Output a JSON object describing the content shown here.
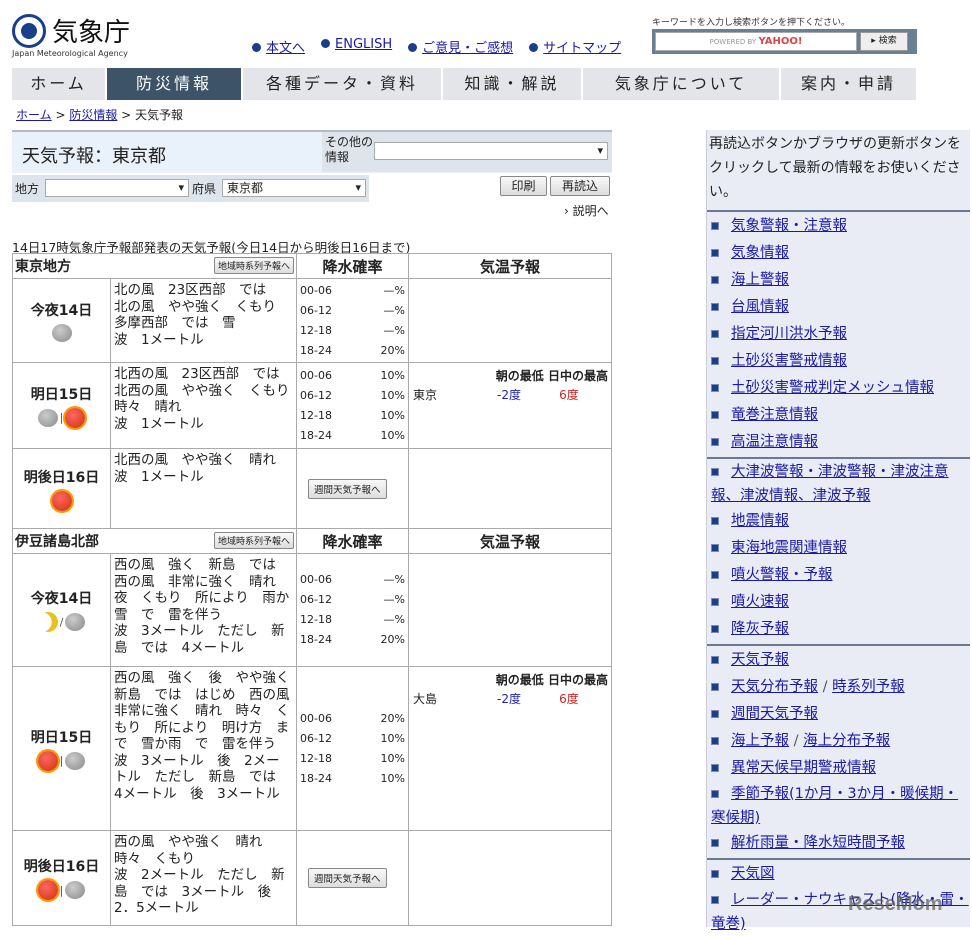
{
  "header": {
    "logo_text": "気象庁",
    "logo_sub": "Japan Meteorological Agency",
    "links": [
      "本文へ",
      "ENGLISH",
      "ご意見・ご感想",
      "サイトマップ"
    ],
    "search_hint": "キーワードを入力し検索ボタンを押下ください。",
    "search_placeholder": "POWERED BY",
    "search_brand": "YAHOO!",
    "search_button": "検索"
  },
  "nav": [
    "ホーム",
    "防災情報",
    "各種データ・資料",
    "知識・解説",
    "気象庁について",
    "案内・申請"
  ],
  "breadcrumb": {
    "home": "ホーム",
    "disaster": "防災情報",
    "current": "天気予報"
  },
  "page": {
    "title": "天気予報：東京都",
    "other_label": "その他の情報",
    "other_value": "",
    "region_label": "地方",
    "region_value": "",
    "pref_label": "府県",
    "pref_value": "東京都",
    "print": "印刷",
    "reload": "再読込",
    "explain": "説明へ",
    "issued": "14日17時気象庁予報部発表の天気予報(今日14日から明後日16日まで)"
  },
  "table": {
    "area_button": "地域時系列予報へ",
    "precip_header": "降水確率",
    "temp_header": "気温予報",
    "weekly_button": "週間天気予報へ",
    "temp_low_label": "朝の最低",
    "temp_high_label": "日中の最高"
  },
  "regions": [
    {
      "name": "東京地方",
      "rows": [
        {
          "day": "今夜14日",
          "icons": [
            "cloud"
          ],
          "desc": "北の風　23区西部　では　北の風　やや強く　くもり　多摩西部　では　雪\n波　1メートル",
          "precip": [
            [
              "00-06",
              "—%"
            ],
            [
              "06-12",
              "—%"
            ],
            [
              "12-18",
              "—%"
            ],
            [
              "18-24",
              "20%"
            ]
          ]
        },
        {
          "day": "明日15日",
          "icons": [
            "cloud",
            "sun"
          ],
          "desc": "北西の風　23区西部　では　北西の風　やや強く　くもり　時々　晴れ\n波　1メートル",
          "precip": [
            [
              "00-06",
              "10%"
            ],
            [
              "06-12",
              "10%"
            ],
            [
              "12-18",
              "10%"
            ],
            [
              "18-24",
              "10%"
            ]
          ],
          "temp": {
            "city": "東京",
            "low": "-2度",
            "high": "6度"
          }
        },
        {
          "day": "明後日16日",
          "icons": [
            "sun"
          ],
          "desc": "北西の風　やや強く　晴れ\n波　1メートル",
          "weekly": true
        }
      ]
    },
    {
      "name": "伊豆諸島北部",
      "rows": [
        {
          "day": "今夜14日",
          "icons": [
            "moon",
            "cloud"
          ],
          "desc": "西の風　強く　新島　では　西の風　非常に強く　晴れ　夜　くもり　所により　雨か雪　で　雷を伴う\n波　3メートル　ただし　新島　では　4メートル",
          "precip": [
            [
              "00-06",
              "—%"
            ],
            [
              "06-12",
              "—%"
            ],
            [
              "12-18",
              "—%"
            ],
            [
              "18-24",
              "20%"
            ]
          ]
        },
        {
          "day": "明日15日",
          "icons": [
            "sun",
            "cloud"
          ],
          "desc": "西の風　強く　後　やや強く　新島　では　はじめ　西の風　非常に強く　晴れ　時々　くもり　所により　明け方　まで　雪か雨　で　雷を伴う\n波　3メートル　後　2メートル　ただし　新島　では　4メートル　後　3メートル",
          "precip": [
            [
              "00-06",
              "20%"
            ],
            [
              "06-12",
              "10%"
            ],
            [
              "12-18",
              "10%"
            ],
            [
              "18-24",
              "10%"
            ]
          ],
          "temp": {
            "city": "大島",
            "low": "-2度",
            "high": "6度"
          }
        },
        {
          "day": "明後日16日",
          "icons": [
            "sun",
            "cloud"
          ],
          "desc": "西の風　やや強く　晴れ　時々　くもり\n波　2メートル　ただし　新島　では　3メートル　後　2．5メートル",
          "weekly": true
        }
      ]
    }
  ],
  "sidebar": {
    "note": "再読込ボタンかブラウザの更新ボタンをクリックして最新の情報をお使いください。",
    "groups": [
      [
        [
          "気象警報・注意報"
        ],
        [
          "気象情報"
        ],
        [
          "海上警報"
        ],
        [
          "台風情報"
        ],
        [
          "指定河川洪水予報"
        ],
        [
          "土砂災害警戒情報"
        ],
        [
          "土砂災害警戒判定メッシュ情報"
        ],
        [
          "竜巻注意情報"
        ],
        [
          "高温注意情報"
        ]
      ],
      [
        [
          "大津波警報・津波警報・津波注意報、津波情報、津波予報"
        ],
        [
          "地震情報"
        ],
        [
          "東海地震関連情報"
        ],
        [
          "噴火警報・予報"
        ],
        [
          "噴火速報"
        ],
        [
          "降灰予報"
        ]
      ],
      [
        [
          "天気予報"
        ],
        [
          "天気分布予報",
          "時系列予報"
        ],
        [
          "週間天気予報"
        ],
        [
          "海上予報",
          "海上分布予報"
        ],
        [
          "異常天候早期警戒情報"
        ],
        [
          "季節予報(1か月・3か月・暖候期・寒候期)"
        ],
        [
          "解析雨量・降水短時間予報"
        ]
      ],
      [
        [
          "天気図"
        ],
        [
          "レーダー・ナウキャスト(降水・雷・竜巻)"
        ]
      ]
    ]
  },
  "watermark": "ReseMom",
  "colors": {
    "nav_active": "#3d5468",
    "link": "#1a1aa6",
    "sidebar_bg": "#e9ecf5",
    "temp_low": "#2222aa",
    "temp_high": "#cc2222"
  }
}
